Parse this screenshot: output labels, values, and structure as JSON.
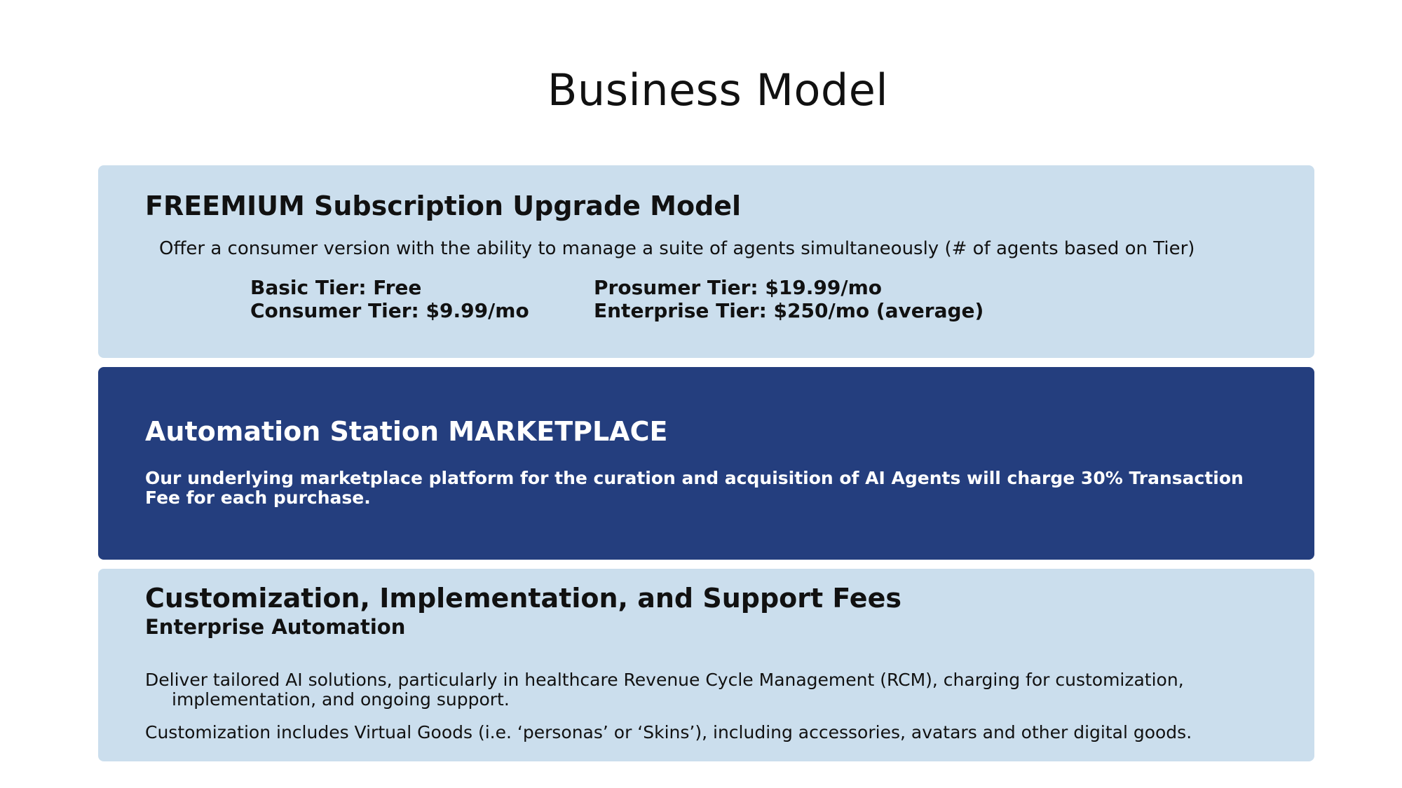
{
  "page": {
    "title": "Business Model"
  },
  "freemium": {
    "heading": "FREEMIUM Subscription Upgrade Model",
    "description": "Offer a consumer version with the ability to manage a suite of agents simultaneously (# of agents based on Tier)",
    "tiers": [
      "Basic Tier: Free",
      "Consumer Tier: $9.99/mo",
      "Prosumer Tier: $19.99/mo",
      "Enterprise Tier: $250/mo (average)"
    ]
  },
  "marketplace": {
    "heading": "Automation Station MARKETPLACE",
    "description": "Our underlying marketplace platform for the curation and acquisition of AI Agents will charge 30% Transaction Fee for each purchase."
  },
  "customization": {
    "heading": "Customization, Implementation, and Support Fees",
    "subheading": "Enterprise Automation",
    "paragraphs": [
      "Deliver tailored AI solutions, particularly in healthcare Revenue Cycle Management (RCM), charging for customization, implementation, and ongoing support.",
      "Customization includes Virtual Goods (i.e. ‘personas’ or ‘Skins’), including accessories, avatars and other digital goods."
    ]
  },
  "colors": {
    "light_panel": "#cbdeed",
    "dark_panel": "#243e7e",
    "text": "#111111"
  }
}
